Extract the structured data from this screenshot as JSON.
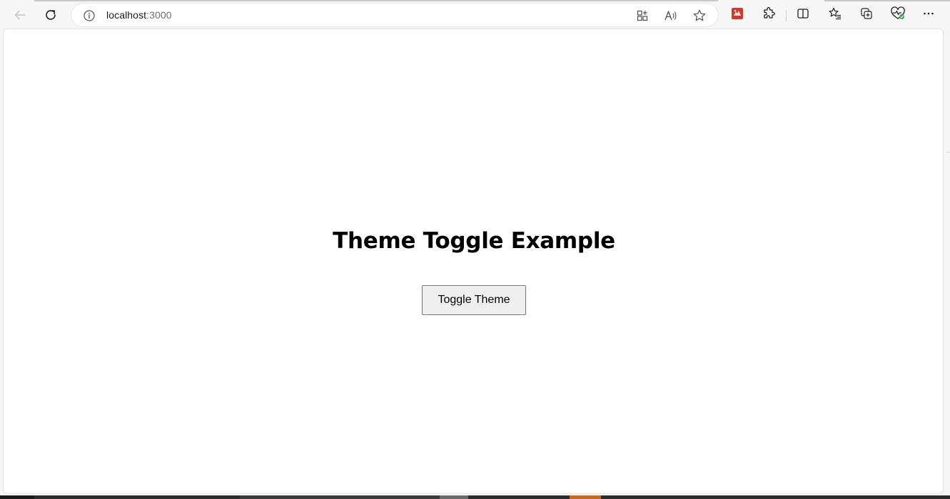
{
  "browser": {
    "address": {
      "host": "localhost",
      "port": ":3000"
    },
    "icons": {
      "back": "back-arrow-icon",
      "reload": "reload-icon",
      "info": "info-icon",
      "app_available": "app-available-icon",
      "read_aloud": "read-aloud-icon",
      "favorite": "star-icon",
      "extension_red": "extension-red-icon",
      "extensions": "puzzle-piece-icon",
      "split_screen": "split-screen-icon",
      "favorites": "favorites-list-icon",
      "collections": "collections-icon",
      "browser_essentials": "heart-pulse-icon",
      "more": "more-dots-icon"
    },
    "colors": {
      "extension_red": "#d9362b",
      "status_green": "#2e9e44"
    }
  },
  "page": {
    "title": "Theme Toggle Example",
    "toggle_button_label": "Toggle Theme"
  }
}
